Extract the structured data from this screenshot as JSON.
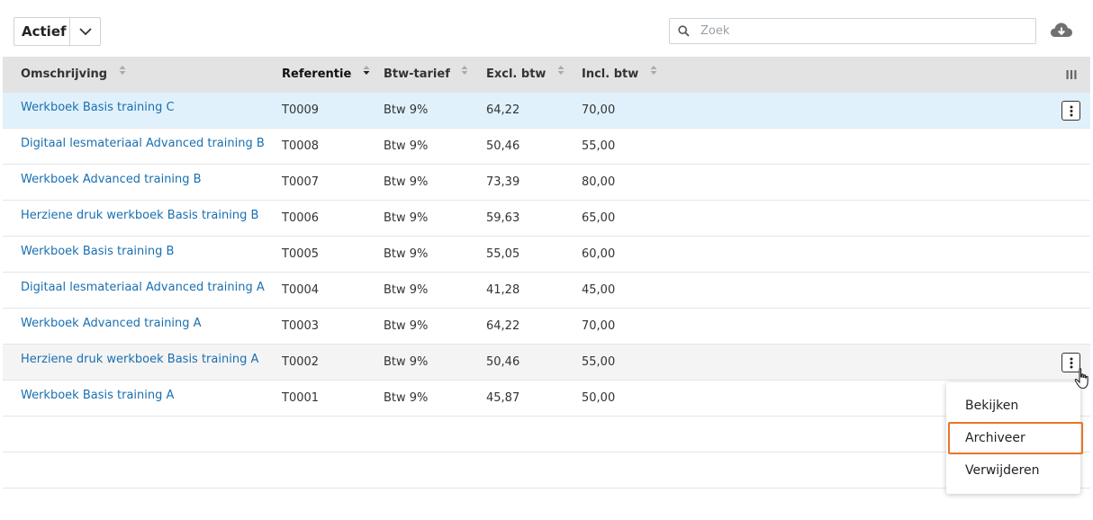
{
  "filter": {
    "selected": "Actief"
  },
  "search": {
    "placeholder": "Zoek",
    "value": ""
  },
  "columns": [
    {
      "label": "Omschrijving",
      "sort": "none"
    },
    {
      "label": "Referentie",
      "sort": "desc"
    },
    {
      "label": "Btw-tarief",
      "sort": "none"
    },
    {
      "label": "Excl. btw",
      "sort": "none"
    },
    {
      "label": "Incl. btw",
      "sort": "none"
    }
  ],
  "rows": [
    {
      "desc": "Werkboek Basis training C",
      "ref": "T0009",
      "btw": "Btw 9%",
      "excl": "64,22",
      "incl": "70,00"
    },
    {
      "desc": "Digitaal lesmateriaal Advanced training B",
      "ref": "T0008",
      "btw": "Btw 9%",
      "excl": "50,46",
      "incl": "55,00"
    },
    {
      "desc": "Werkboek Advanced training B",
      "ref": "T0007",
      "btw": "Btw 9%",
      "excl": "73,39",
      "incl": "80,00"
    },
    {
      "desc": "Herziene druk werkboek Basis training B",
      "ref": "T0006",
      "btw": "Btw 9%",
      "excl": "59,63",
      "incl": "65,00"
    },
    {
      "desc": "Werkboek Basis training B",
      "ref": "T0005",
      "btw": "Btw 9%",
      "excl": "55,05",
      "incl": "60,00"
    },
    {
      "desc": "Digitaal lesmateriaal Advanced training A",
      "ref": "T0004",
      "btw": "Btw 9%",
      "excl": "41,28",
      "incl": "45,00"
    },
    {
      "desc": "Werkboek Advanced training A",
      "ref": "T0003",
      "btw": "Btw 9%",
      "excl": "64,22",
      "incl": "70,00"
    },
    {
      "desc": "Herziene druk werkboek Basis training A",
      "ref": "T0002",
      "btw": "Btw 9%",
      "excl": "50,46",
      "incl": "55,00"
    },
    {
      "desc": "Werkboek Basis training A",
      "ref": "T0001",
      "btw": "Btw 9%",
      "excl": "45,87",
      "incl": "50,00"
    }
  ],
  "context_menu": {
    "items": [
      "Bekijken",
      "Archiveer",
      "Verwijderen"
    ],
    "focused": "Archiveer"
  },
  "icons": {
    "chevron": "chevron-down-icon",
    "search": "search-icon",
    "download": "cloud-download-icon",
    "columns": "columns-icon",
    "row_actions": "kebab-icon",
    "cursor": "hand-pointer-icon"
  },
  "colors": {
    "link": "#1a6fb0",
    "selected_row": "#e0f1fc",
    "hover_row": "#f4f4f4",
    "header": "#e3e3e3",
    "menu_focus": "#e8752a"
  }
}
